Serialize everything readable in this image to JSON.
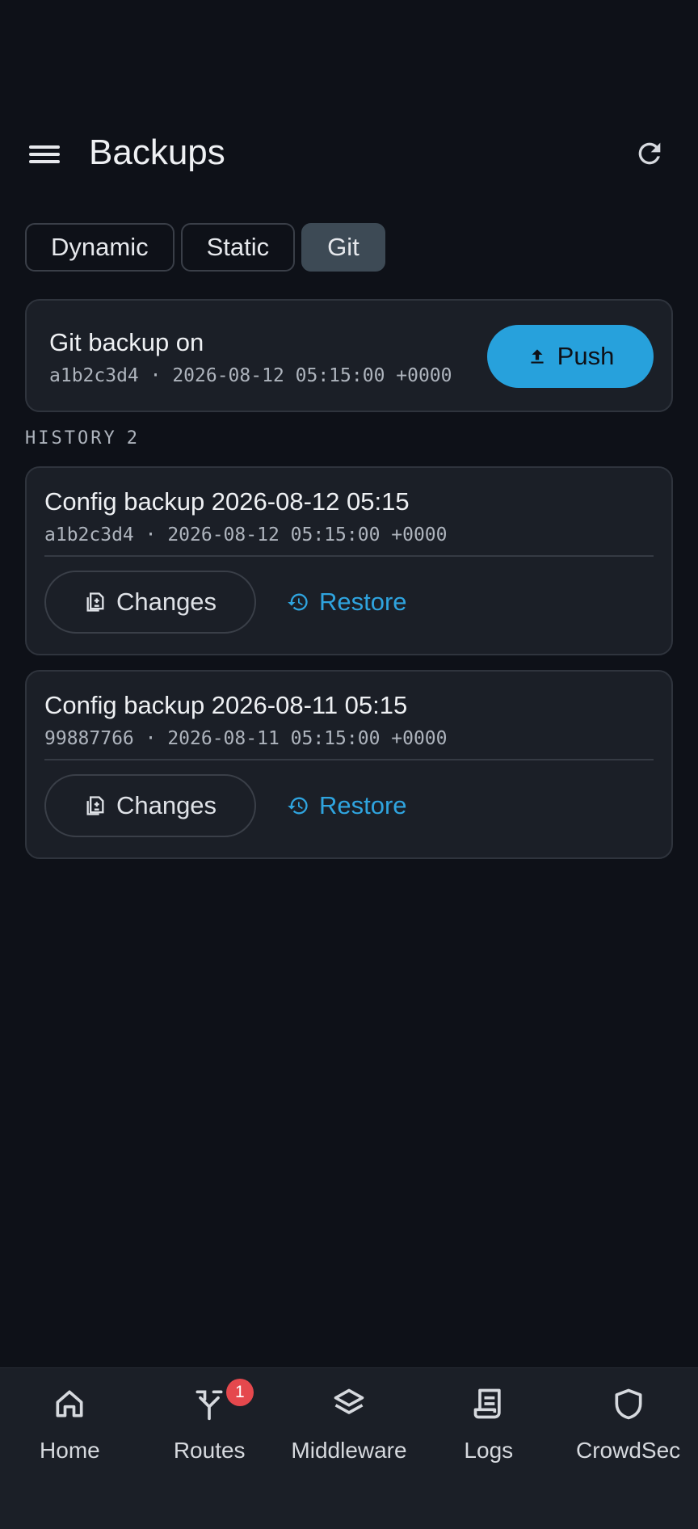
{
  "header": {
    "title": "Backups"
  },
  "tabs": [
    {
      "label": "Dynamic",
      "active": false
    },
    {
      "label": "Static",
      "active": false
    },
    {
      "label": "Git",
      "active": true
    }
  ],
  "git_status": {
    "title": "Git backup on",
    "commit": "a1b2c3d4 · 2026-08-12 05:15:00 +0000",
    "push_label": "Push"
  },
  "history": {
    "label": "HISTORY",
    "count": "2",
    "items": [
      {
        "title": "Config backup 2026-08-12 05:15",
        "commit": "a1b2c3d4 · 2026-08-12 05:15:00 +0000",
        "changes_label": "Changes",
        "restore_label": "Restore"
      },
      {
        "title": "Config backup 2026-08-11 05:15",
        "commit": "99887766 · 2026-08-11 05:15:00 +0000",
        "changes_label": "Changes",
        "restore_label": "Restore"
      }
    ]
  },
  "nav": [
    {
      "label": "Home",
      "icon": "home-icon"
    },
    {
      "label": "Routes",
      "icon": "routes-icon",
      "badge": "1"
    },
    {
      "label": "Middleware",
      "icon": "layers-icon"
    },
    {
      "label": "Logs",
      "icon": "logs-icon"
    },
    {
      "label": "CrowdSec",
      "icon": "shield-icon"
    }
  ],
  "colors": {
    "accent": "#27a1dc",
    "background": "#0e1118",
    "card": "#1b1f27",
    "badge": "#e5484d"
  }
}
